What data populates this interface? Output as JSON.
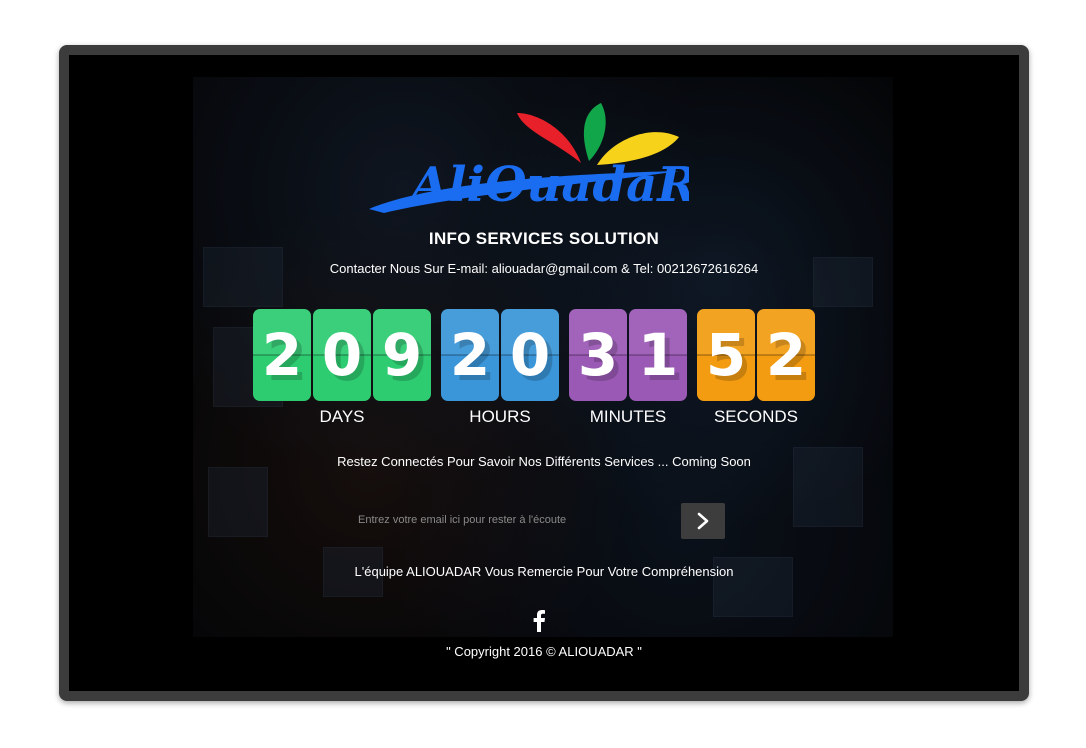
{
  "brand": {
    "logo_text": "AliOuadaR",
    "logo_colors": {
      "blue": "#1a6cf0",
      "red": "#e8202a",
      "green": "#12a64a",
      "yellow": "#f7d21a"
    },
    "subtitle": "INFO SERVICES SOLUTION"
  },
  "contact": {
    "text": "Contacter Nous Sur E-mail: aliouadar@gmail.com & Tel: 00212672616264"
  },
  "countdown": {
    "days": {
      "digits": [
        "2",
        "0",
        "9"
      ],
      "label": "DAYS",
      "color": "#2ecc71"
    },
    "hours": {
      "digits": [
        "2",
        "0"
      ],
      "label": "HOURS",
      "color": "#3a96d8"
    },
    "minutes": {
      "digits": [
        "3",
        "1"
      ],
      "label": "MINUTES",
      "color": "#9b59b6"
    },
    "seconds": {
      "digits": [
        "5",
        "2"
      ],
      "label": "SECONDS",
      "color": "#f39c12"
    }
  },
  "tagline": "Restez Connectés Pour Savoir Nos Différents Services ... Coming Soon",
  "subscribe": {
    "placeholder": "Entrez votre email ici pour rester à l'écoute",
    "submit_icon": "chevron-right-icon"
  },
  "thanks": "L'équipe ALIOUADAR Vous Remercie Pour Votre Compréhension",
  "social": {
    "facebook_icon": "facebook-icon"
  },
  "copyright": "\" Copyright 2016 © ALIOUADAR \""
}
